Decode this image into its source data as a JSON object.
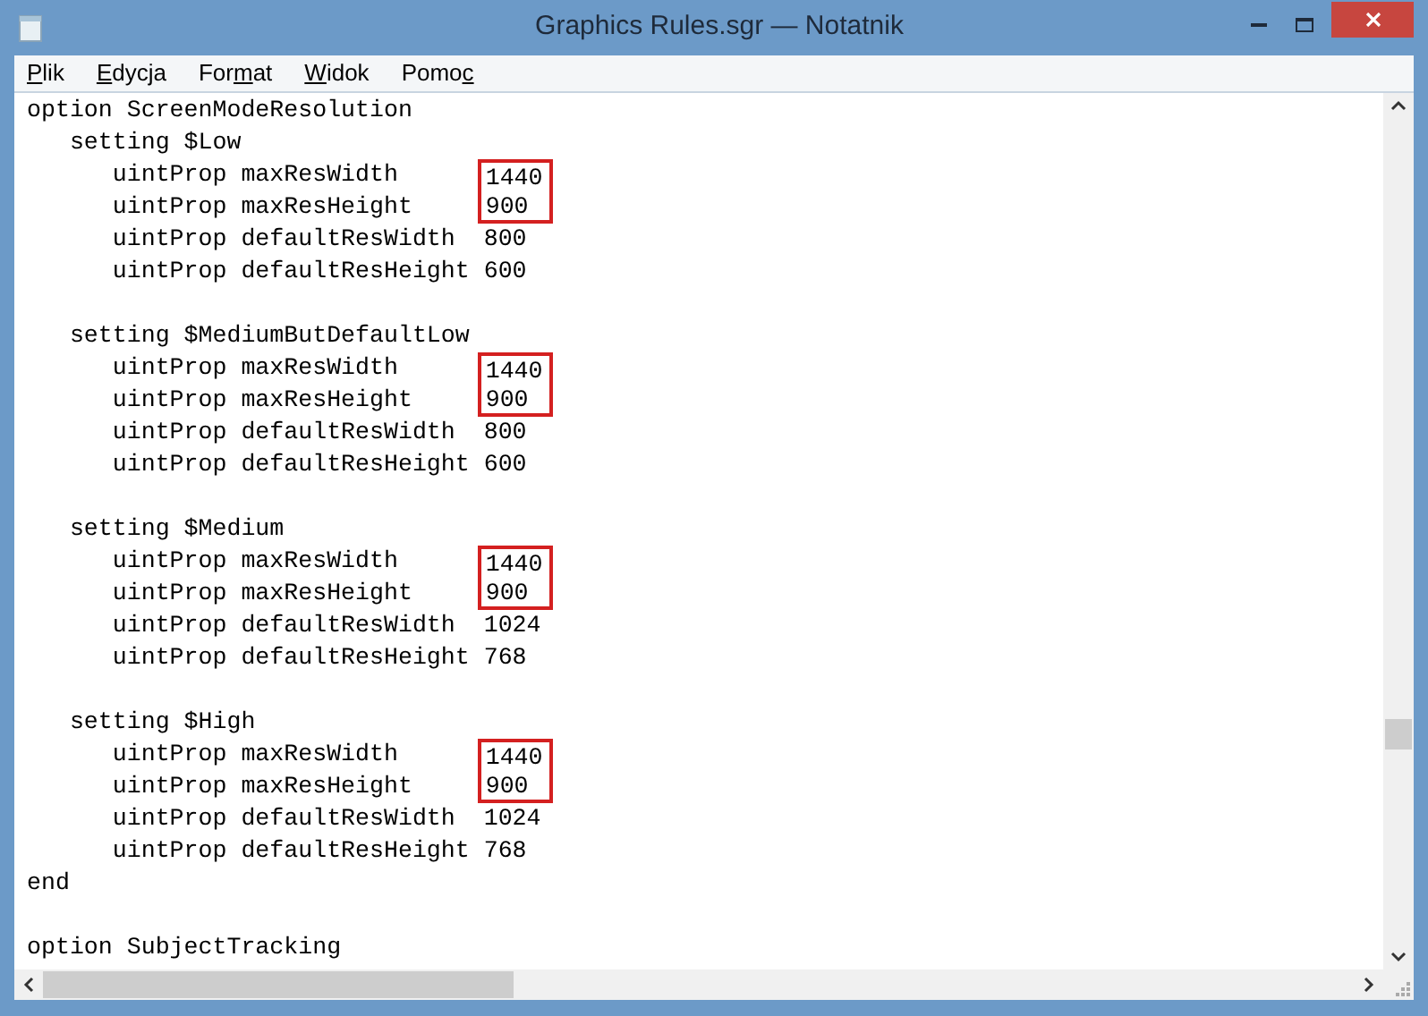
{
  "window": {
    "title": "Graphics Rules.sgr — Notatnik"
  },
  "menu": [
    {
      "segments": [
        {
          "text": "P",
          "underlined": true
        },
        {
          "text": "lik",
          "underlined": false
        }
      ]
    },
    {
      "segments": [
        {
          "text": "E",
          "underlined": true
        },
        {
          "text": "dycja",
          "underlined": false
        }
      ]
    },
    {
      "segments": [
        {
          "text": "For",
          "underlined": false
        },
        {
          "text": "m",
          "underlined": true
        },
        {
          "text": "at",
          "underlined": false
        }
      ]
    },
    {
      "segments": [
        {
          "text": "W",
          "underlined": true
        },
        {
          "text": "idok",
          "underlined": false
        }
      ]
    },
    {
      "segments": [
        {
          "text": "Pomo",
          "underlined": false
        },
        {
          "text": "c",
          "underlined": true
        }
      ]
    }
  ],
  "paragraphs": [
    {
      "lines": [
        {
          "code": "option ScreenModeResolution"
        },
        {
          "code": "   setting $Low"
        },
        {
          "code": "      uintProp maxResWidth      ",
          "value": "1440",
          "highlighted": true
        },
        {
          "code": "      uintProp maxResHeight     ",
          "value": "900",
          "highlighted": true
        },
        {
          "code": "      uintProp defaultResWidth  ",
          "value": "800",
          "highlighted": false
        },
        {
          "code": "      uintProp defaultResHeight ",
          "value": "600",
          "highlighted": false
        }
      ]
    },
    {
      "lines": [
        {
          "code": "   setting $MediumButDefaultLow"
        },
        {
          "code": "      uintProp maxResWidth      ",
          "value": "1440",
          "highlighted": true
        },
        {
          "code": "      uintProp maxResHeight     ",
          "value": "900",
          "highlighted": true
        },
        {
          "code": "      uintProp defaultResWidth  ",
          "value": "800",
          "highlighted": false
        },
        {
          "code": "      uintProp defaultResHeight ",
          "value": "600",
          "highlighted": false
        }
      ]
    },
    {
      "lines": [
        {
          "code": "   setting $Medium"
        },
        {
          "code": "      uintProp maxResWidth      ",
          "value": "1440",
          "highlighted": true
        },
        {
          "code": "      uintProp maxResHeight     ",
          "value": "900",
          "highlighted": true
        },
        {
          "code": "      uintProp defaultResWidth  ",
          "value": "1024",
          "highlighted": false
        },
        {
          "code": "      uintProp defaultResHeight ",
          "value": "768",
          "highlighted": false
        }
      ]
    },
    {
      "lines": [
        {
          "code": "   setting $High"
        },
        {
          "code": "      uintProp maxResWidth      ",
          "value": "1440",
          "highlighted": true
        },
        {
          "code": "      uintProp maxResHeight     ",
          "value": "900",
          "highlighted": true
        },
        {
          "code": "      uintProp defaultResWidth  ",
          "value": "1024",
          "highlighted": false
        },
        {
          "code": "      uintProp defaultResHeight ",
          "value": "768",
          "highlighted": false
        },
        {
          "code": "end"
        }
      ]
    },
    {
      "lines": [
        {
          "code": "option SubjectTracking"
        }
      ]
    }
  ]
}
